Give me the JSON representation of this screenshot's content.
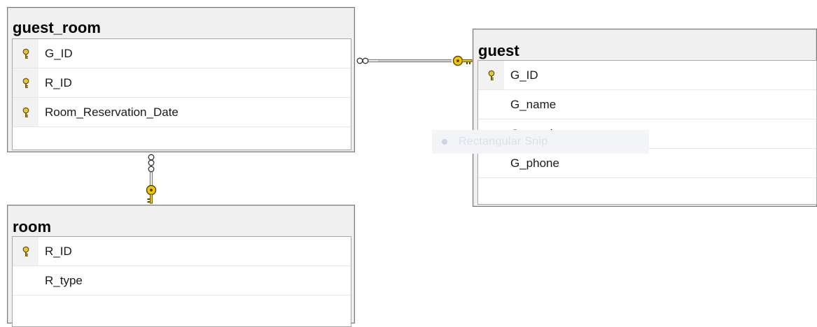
{
  "tables": {
    "guest_room": {
      "title": "guest_room",
      "columns": [
        {
          "name": "G_ID",
          "key": true
        },
        {
          "name": "R_ID",
          "key": true
        },
        {
          "name": "Room_Reservation_Date",
          "key": true
        }
      ]
    },
    "guest": {
      "title": "guest",
      "columns": [
        {
          "name": "G_ID",
          "key": true
        },
        {
          "name": "G_name",
          "key": false
        },
        {
          "name": "G_gender",
          "key": false
        },
        {
          "name": "G_phone",
          "key": false
        }
      ]
    },
    "room": {
      "title": "room",
      "columns": [
        {
          "name": "R_ID",
          "key": true
        },
        {
          "name": "R_type",
          "key": false
        }
      ]
    }
  },
  "relationships": [
    {
      "from": "guest_room",
      "to": "guest",
      "from_end": "many",
      "to_end": "one"
    },
    {
      "from": "guest_room",
      "to": "room",
      "from_end": "many",
      "to_end": "one"
    }
  ],
  "tooltip": {
    "label": "Rectangular Snip"
  },
  "colors": {
    "key_icon": "#f0c800",
    "connector": "#808080",
    "table_header": "#f0f0f0",
    "border": "#7a7a7a"
  },
  "icons": {
    "primary_key": "key-icon"
  }
}
